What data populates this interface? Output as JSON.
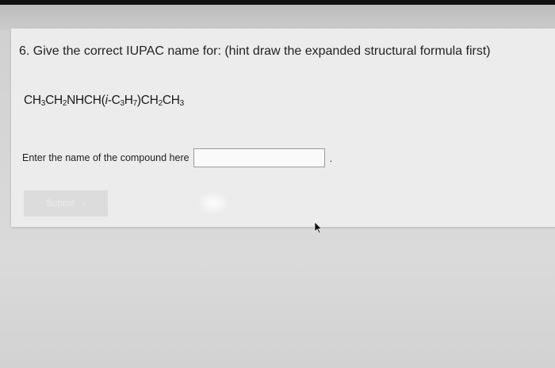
{
  "question": {
    "text": "6. Give the correct IUPAC name for: (hint draw the expanded structural formula first)"
  },
  "formula": {
    "p1": "CH",
    "s1": "3",
    "p2": "CH",
    "s2": "2",
    "p3": "NHCH(",
    "p4": "i",
    "p5": "-C",
    "s3": "3",
    "p6": "H",
    "s4": "7",
    "p7": ")CH",
    "s5": "2",
    "p8": "CH",
    "s6": "3"
  },
  "answer": {
    "label": "Enter the name of the compound here",
    "value": "",
    "suffix": "."
  },
  "submit": {
    "label": "Submit",
    "chevron": "›"
  },
  "icons": {
    "cursor": "mouse-pointer-icon"
  }
}
